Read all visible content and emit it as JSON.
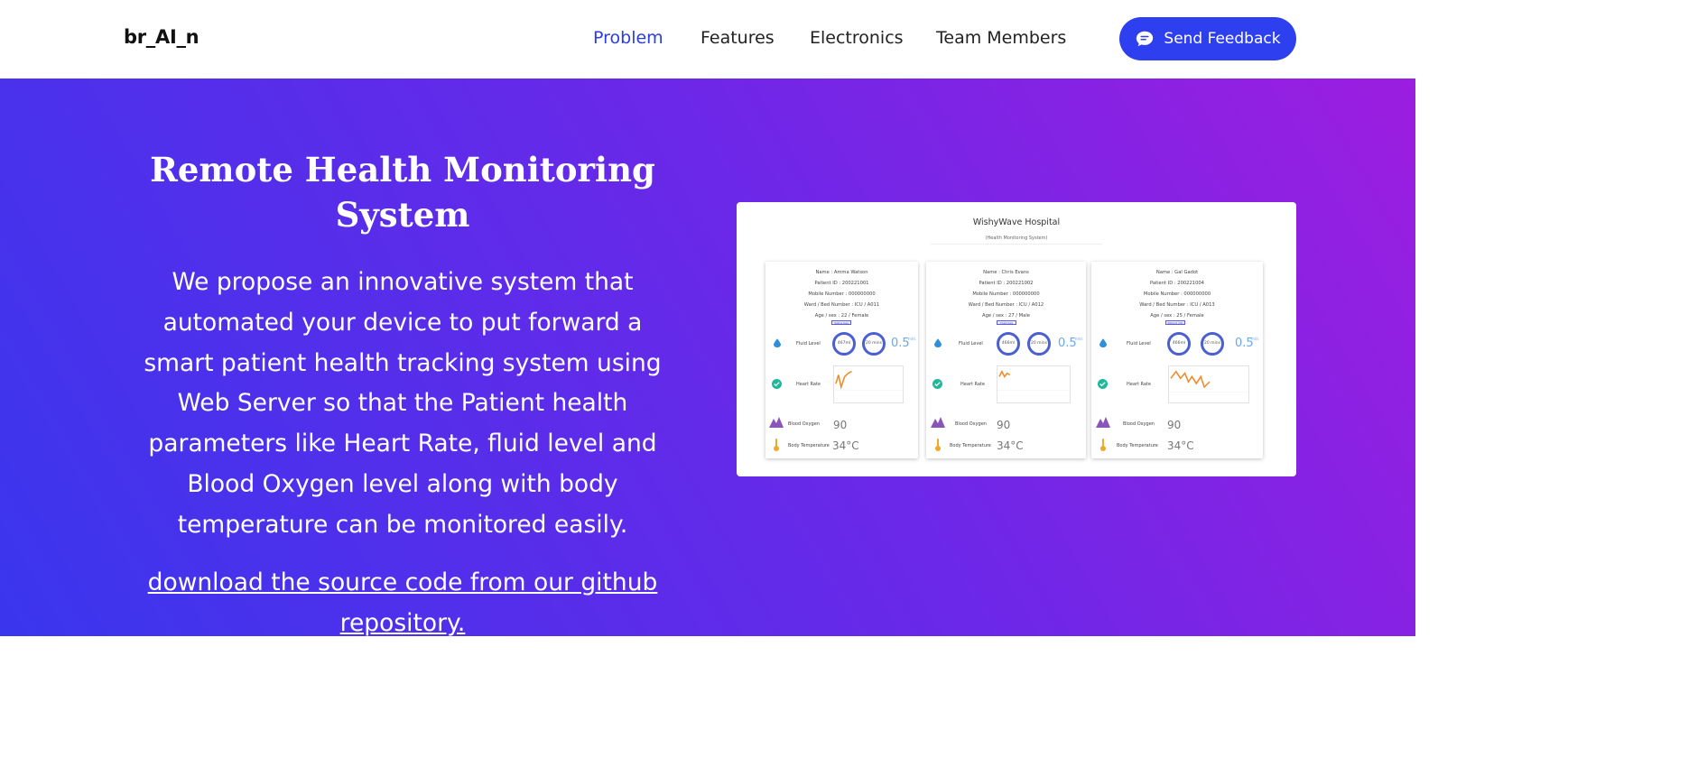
{
  "nav": {
    "brand": "br_AI_n",
    "links": [
      "Problem",
      "Features",
      "Electronics",
      "Team Members"
    ],
    "active": "Problem",
    "feedback_label": "Send Feedback"
  },
  "hero": {
    "title": "Remote Health Monitoring System",
    "description": "We propose an innovative system that automated your device to put forward a smart patient health tracking system using Web Server so that the Patient health parameters like Heart Rate, fluid level and Blood Oxygen level along with body temperature can be monitored easily.",
    "link_text": "download the source code from our github repository."
  },
  "dashboard": {
    "title": "WishyWave Hospital",
    "subtitle": "(Health Monitoring System)",
    "labels": {
      "fluid": "Fluid Level",
      "heart": "Heart Rate",
      "oxygen": "Blood Oxygen",
      "temp": "Body Temperature"
    },
    "flow_unit": "ml/s",
    "patients": [
      {
        "name": "Name : Amma Watson",
        "id": "Patient ID : 200221001",
        "mobile": "Mobile Number : 000000000",
        "ward": "Ward / Bed Number : ICU / A011",
        "age": "Age / sex : 22 / Female",
        "tag": "Saline bag",
        "ring1": "467ml",
        "ring2": "20 mins",
        "flow": "0.5",
        "oxygen": "90",
        "temp": "34°C"
      },
      {
        "name": "Name : Chris Evans",
        "id": "Patient ID : 200221002",
        "mobile": "Mobile Number : 000000000",
        "ward": "Ward / Bed Number : ICU / A012",
        "age": "Age / sex : 27 / Male",
        "tag": "Fluid bag",
        "ring1": "466ml",
        "ring2": "20 mins",
        "flow": "0.5",
        "oxygen": "90",
        "temp": "34°C"
      },
      {
        "name": "Name : Gal Gadot",
        "id": "Patient ID : 200221004",
        "mobile": "Mobile Number : 000000000",
        "ward": "Ward / Bed Number : ICU / A013",
        "age": "Age / sex : 25 / Female",
        "tag": "Patient info",
        "ring1": "466ml",
        "ring2": "20 mins",
        "flow": "0.5",
        "oxygen": "90",
        "temp": "34°C"
      }
    ]
  }
}
